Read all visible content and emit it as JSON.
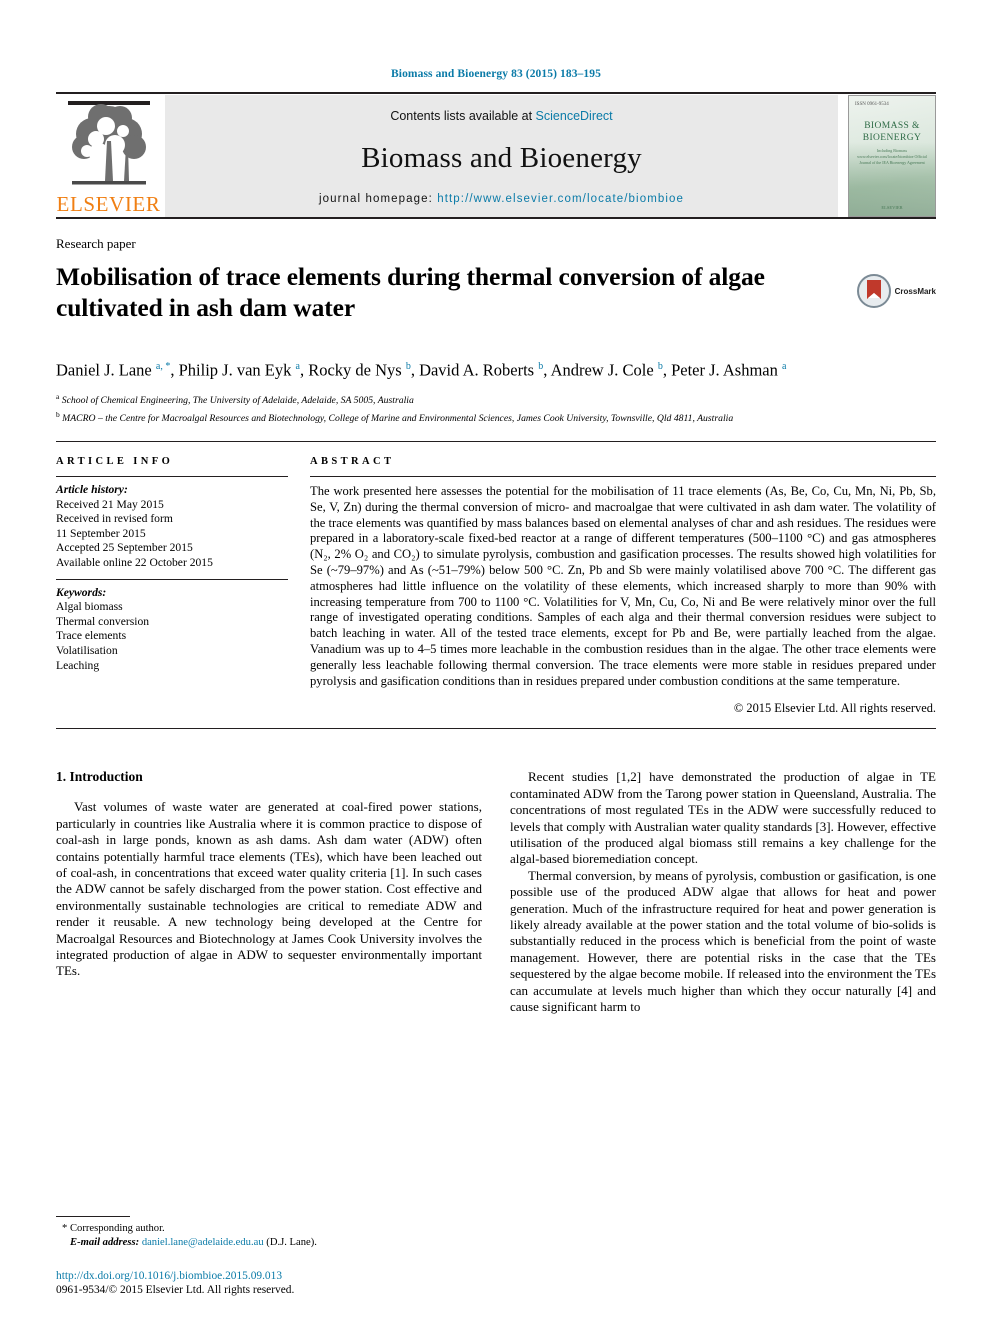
{
  "running_head": "Biomass and Bioenergy 83 (2015) 183–195",
  "masthead": {
    "publisher_logo_text": "ELSEVIER",
    "contents_prefix": "Contents lists available at ",
    "contents_link": "ScienceDirect",
    "journal_title": "Biomass and Bioenergy",
    "homepage_prefix": "journal homepage: ",
    "homepage_url": "http://www.elsevier.com/locate/biombioe",
    "cover": {
      "top_label": "ISSN 0961-9534",
      "title_line1": "BIOMASS &",
      "title_line2": "BIOENERGY",
      "subtitle": "Including Biomass\nwww.elsevier.com/locate/biombioe\nOfficial Journal of the\nIEA Bioenergy Agreement",
      "footer": "ELSEVIER"
    }
  },
  "article": {
    "doctype": "Research paper",
    "title": "Mobilisation of trace elements during thermal conversion of algae cultivated in ash dam water",
    "crossmark_label": "CrossMark",
    "authors_html": "Daniel J. Lane <sup>a, *</sup>, Philip J. van Eyk <sup>a</sup>, Rocky de Nys <sup>b</sup>, David A. Roberts <sup>b</sup>, Andrew J. Cole <sup>b</sup>, Peter J. Ashman <sup>a</sup>",
    "affiliations": [
      "School of Chemical Engineering, The University of Adelaide, Adelaide, SA 5005, Australia",
      "MACRO – the Centre for Macroalgal Resources and Biotechnology, College of Marine and Environmental Sciences, James Cook University, Townsville, Qld 4811, Australia"
    ],
    "affiliation_markers": [
      "a",
      "b"
    ]
  },
  "article_info": {
    "heading": "ARTICLE INFO",
    "history_label": "Article history:",
    "history": [
      "Received 21 May 2015",
      "Received in revised form",
      "11 September 2015",
      "Accepted 25 September 2015",
      "Available online 22 October 2015"
    ],
    "keywords_label": "Keywords:",
    "keywords": [
      "Algal biomass",
      "Thermal conversion",
      "Trace elements",
      "Volatilisation",
      "Leaching"
    ]
  },
  "abstract": {
    "heading": "ABSTRACT",
    "text": "The work presented here assesses the potential for the mobilisation of 11 trace elements (As, Be, Co, Cu, Mn, Ni, Pb, Sb, Se, V, Zn) during the thermal conversion of micro- and macroalgae that were cultivated in ash dam water. The volatility of the trace elements was quantified by mass balances based on elemental analyses of char and ash residues. The residues were prepared in a laboratory-scale fixed-bed reactor at a range of different temperatures (500–1100 °C) and gas atmospheres (N₂, 2% O₂ and CO₂) to simulate pyrolysis, combustion and gasification processes. The results showed high volatilities for Se (~79–97%) and As (~51–79%) below 500 °C. Zn, Pb and Sb were mainly volatilised above 700 °C. The different gas atmospheres had little influence on the volatility of these elements, which increased sharply to more than 90% with increasing temperature from 700 to 1100 °C. Volatilities for V, Mn, Cu, Co, Ni and Be were relatively minor over the full range of investigated operating conditions. Samples of each alga and their thermal conversion residues were subject to batch leaching in water. All of the tested trace elements, except for Pb and Be, were partially leached from the algae. Vanadium was up to 4–5 times more leachable in the combustion residues than in the algae. The other trace elements were generally less leachable following thermal conversion. The trace elements were more stable in residues prepared under pyrolysis and gasification conditions than in residues prepared under combustion conditions at the same temperature.",
    "copyright": "© 2015 Elsevier Ltd. All rights reserved."
  },
  "body": {
    "section_number_title": "1. Introduction",
    "left_paragraph": "Vast volumes of waste water are generated at coal-fired power stations, particularly in countries like Australia where it is common practice to dispose of coal-ash in large ponds, known as ash dams. Ash dam water (ADW) often contains potentially harmful trace elements (TEs), which have been leached out of coal-ash, in concentrations that exceed water quality criteria [1]. In such cases the ADW cannot be safely discharged from the power station. Cost effective and environmentally sustainable technologies are critical to remediate ADW and render it reusable. A new technology being developed at the Centre for Macroalgal Resources and Biotechnology at James Cook University involves the integrated production of algae in ADW to sequester environmentally important TEs.",
    "left_refs": [
      "[1]"
    ],
    "right_paragraph_1": "Recent studies [1,2] have demonstrated the production of algae in TE contaminated ADW from the Tarong power station in Queensland, Australia. The concentrations of most regulated TEs in the ADW were successfully reduced to levels that comply with Australian water quality standards [3]. However, effective utilisation of the produced algal biomass still remains a key challenge for the algal-based bioremediation concept.",
    "right_paragraph_2": "Thermal conversion, by means of pyrolysis, combustion or gasification, is one possible use of the produced ADW algae that allows for heat and power generation. Much of the infrastructure required for heat and power generation is likely already available at the power station and the total volume of bio-solids is substantially reduced in the process which is beneficial from the point of waste management. However, there are potential risks in the case that the TEs sequestered by the algae become mobile. If released into the environment the TEs can accumulate at levels much higher than which they occur naturally [4] and cause significant harm to"
  },
  "footnotes": {
    "corresponding_author": "Corresponding author.",
    "email_label": "E-mail address:",
    "email": "daniel.lane@adelaide.edu.au",
    "email_suffix": "(D.J. Lane)."
  },
  "footer": {
    "doi": "http://dx.doi.org/10.1016/j.biombioe.2015.09.013",
    "issn_line": "0961-9534/© 2015 Elsevier Ltd. All rights reserved."
  },
  "colors": {
    "link_blue": "#0b7ba8",
    "elsevier_orange": "#f07f13",
    "masthead_grey": "#e9e9e9",
    "crossmark_red": "#c0392b"
  }
}
